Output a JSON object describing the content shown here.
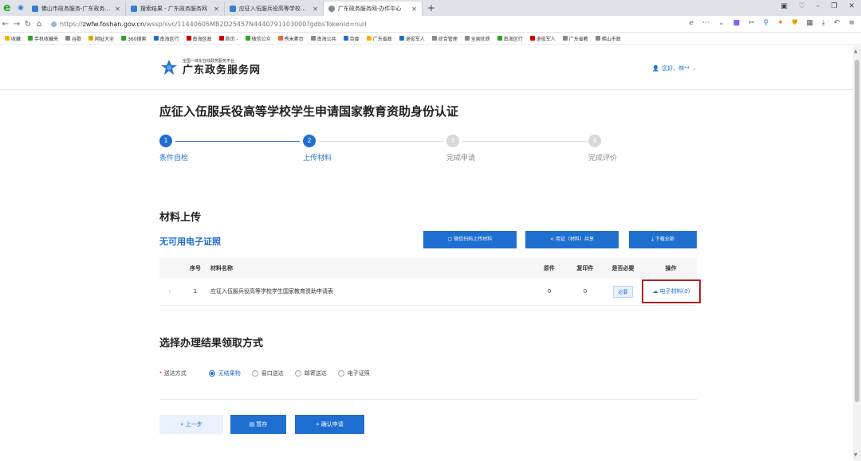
{
  "browser": {
    "tabs": [
      {
        "title": "佛山市政务服务-广东政务服务网",
        "active": false
      },
      {
        "title": "搜索结果 - 广东政务服务网",
        "active": false
      },
      {
        "title": "应征入伍服兵役高等学校学生",
        "active": false
      },
      {
        "title": "广东政务服务网-办件中心",
        "active": true
      }
    ],
    "new_tab": "+",
    "url_prefix": "https://",
    "url_domain": "zwfw.foshan.gov.cn",
    "url_path": "/wssp/svc/11440605MB2D25457N4440791103000?gdbsTokenId=null",
    "bookmarks": [
      "收藏",
      "手机收藏夹",
      "谷歌",
      "网址大全",
      "360搜索",
      "南海区行",
      "南海区政",
      "首页 -",
      "微信公众",
      "秀米素页",
      "南海公共",
      "百度",
      "广东省政",
      "退役军人",
      "综合管理",
      "全国优质",
      "南海区行",
      "退役军人",
      "广东省教",
      "佛山市政"
    ]
  },
  "header": {
    "logo_sub": "全国一体化在线政务服务平台",
    "logo_main": "广东政务服务网",
    "user_greeting": "您好，林**"
  },
  "page_title": "应征入伍服兵役高等学校学生申请国家教育资助身份认证",
  "steps": [
    {
      "num": "1",
      "label": "条件自检",
      "state": "done"
    },
    {
      "num": "2",
      "label": "上传材料",
      "state": "active"
    },
    {
      "num": "3",
      "label": "完成申请",
      "state": "todo"
    },
    {
      "num": "4",
      "label": "完成评价",
      "state": "todo"
    }
  ],
  "materials": {
    "title": "材料上传",
    "no_cert": "无可用电子证照",
    "btn_wechat": "微信扫码上传材料",
    "btn_share": "用证（材料）共享",
    "btn_download": "下载全部",
    "columns": {
      "idx": "序号",
      "name": "材料名称",
      "orig": "原件",
      "copy": "复印件",
      "req": "是否必要",
      "op": "操作"
    },
    "rows": [
      {
        "idx": "1",
        "name": "应征入伍服兵役高等学校学生国家教育资助申请表",
        "orig": "0",
        "copy": "0",
        "req": "必要",
        "op": "电子材料(0)"
      }
    ]
  },
  "delivery": {
    "title": "选择办理结果领取方式",
    "label": "送达方式",
    "options": [
      {
        "label": "无结果物",
        "checked": true
      },
      {
        "label": "窗口送达",
        "checked": false
      },
      {
        "label": "邮寄送达",
        "checked": false
      },
      {
        "label": "电子证照",
        "checked": false
      }
    ]
  },
  "actions": {
    "prev": "« 上一步",
    "save": "暂存",
    "confirm": "» 确认申请"
  },
  "colors": {
    "primary": "#1f6fd1",
    "highlight_border": "#b22222"
  }
}
